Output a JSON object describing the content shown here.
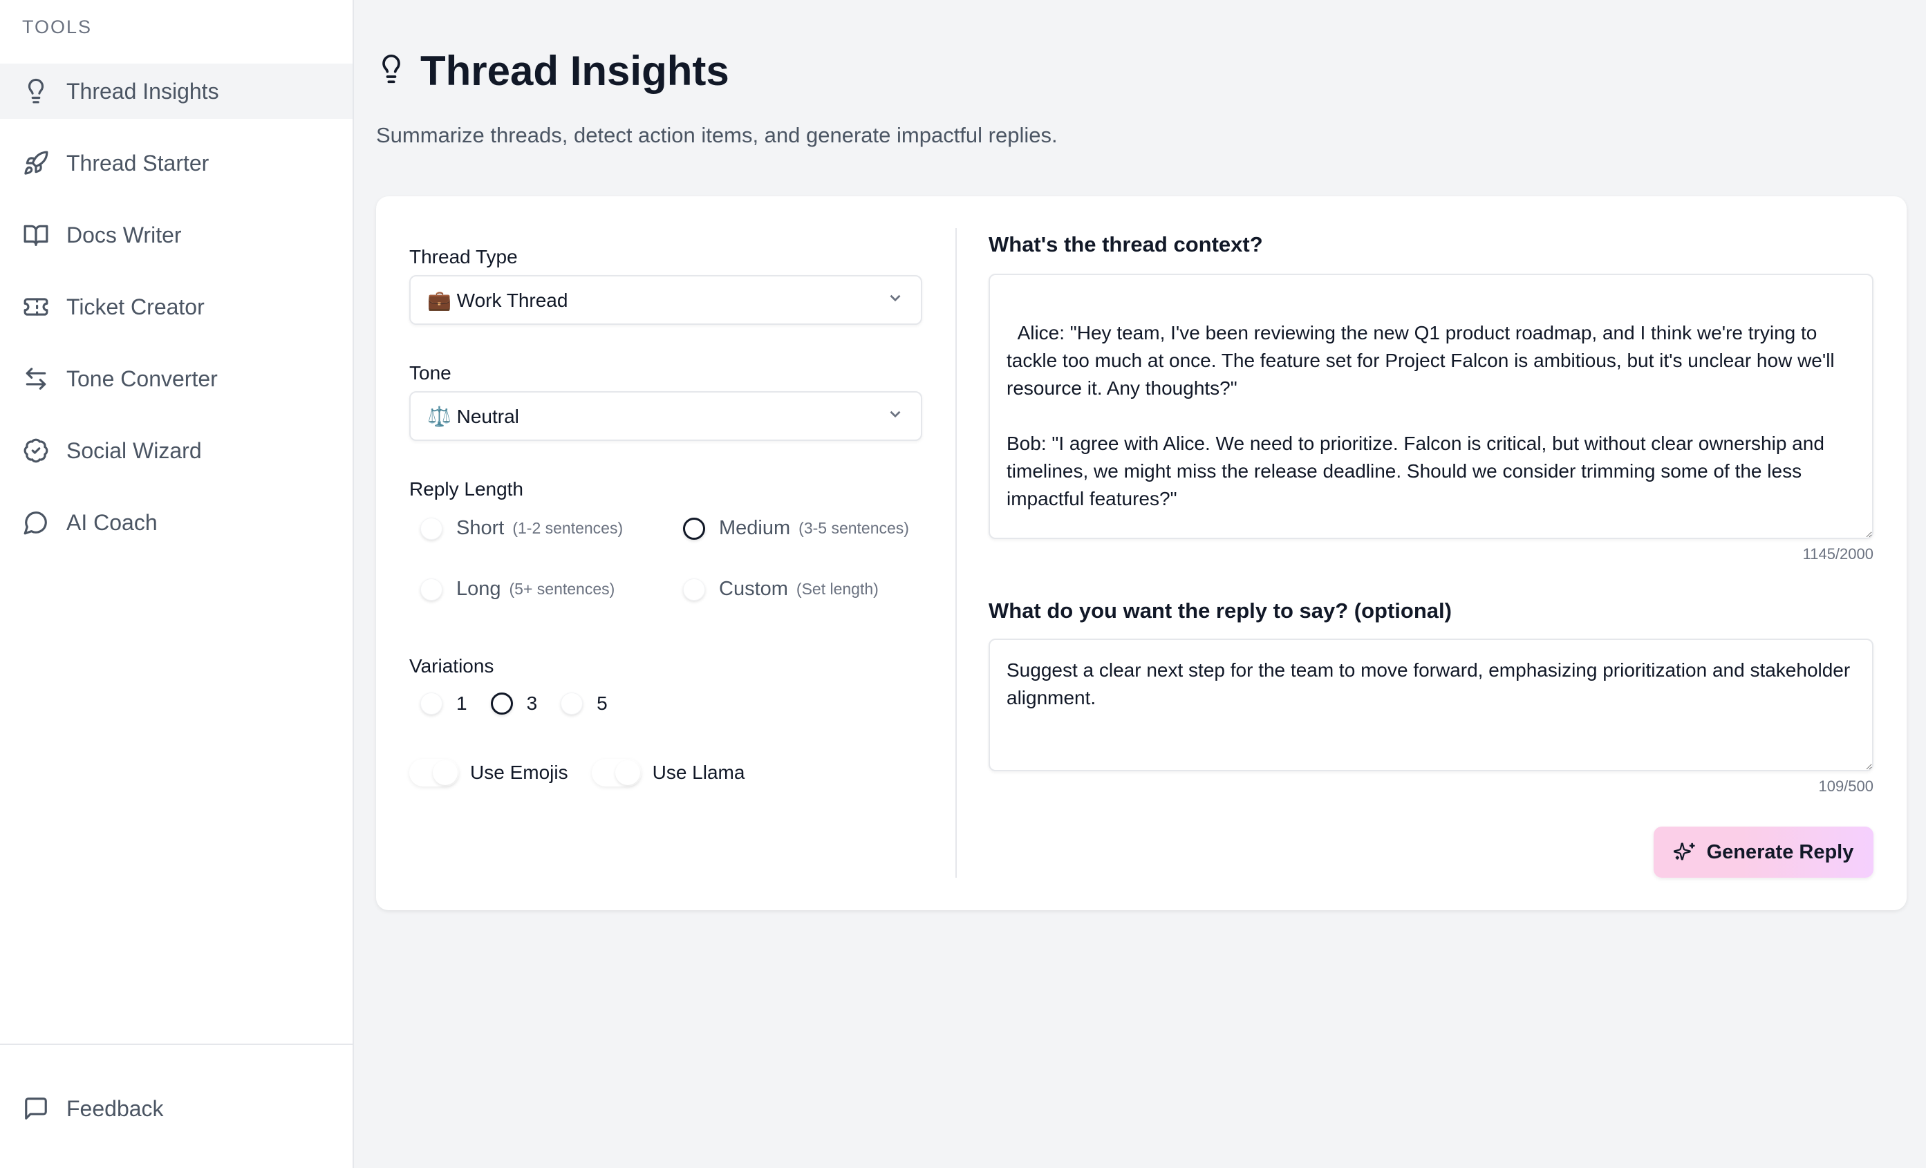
{
  "sidebar": {
    "heading": "TOOLS",
    "items": [
      {
        "label": "Thread Insights",
        "icon": "lightbulb-icon",
        "active": true
      },
      {
        "label": "Thread Starter",
        "icon": "rocket-icon",
        "active": false
      },
      {
        "label": "Docs Writer",
        "icon": "book-open-icon",
        "active": false
      },
      {
        "label": "Ticket Creator",
        "icon": "ticket-icon",
        "active": false
      },
      {
        "label": "Tone Converter",
        "icon": "arrows-left-right-icon",
        "active": false
      },
      {
        "label": "Social Wizard",
        "icon": "badge-check-icon",
        "active": false
      },
      {
        "label": "AI Coach",
        "icon": "message-circle-icon",
        "active": false
      }
    ],
    "footer": {
      "label": "Feedback",
      "icon": "message-square-icon"
    }
  },
  "header": {
    "icon": "lightbulb-icon",
    "title": "Thread Insights",
    "subtitle": "Summarize threads, detect action items, and generate impactful replies."
  },
  "form": {
    "thread_type": {
      "label": "Thread Type",
      "value": "💼 Work Thread"
    },
    "tone": {
      "label": "Tone",
      "value": "⚖️ Neutral"
    },
    "reply_length": {
      "label": "Reply Length",
      "selected": "Medium",
      "options": [
        {
          "label": "Short",
          "hint": "(1-2 sentences)"
        },
        {
          "label": "Medium",
          "hint": "(3-5 sentences)"
        },
        {
          "label": "Long",
          "hint": "(5+ sentences)"
        },
        {
          "label": "Custom",
          "hint": "(Set length)"
        }
      ]
    },
    "variations": {
      "label": "Variations",
      "selected": "3",
      "options": [
        "1",
        "3",
        "5"
      ]
    },
    "toggles": [
      {
        "label": "Use Emojis"
      },
      {
        "label": "Use Llama"
      }
    ],
    "context": {
      "label": "What's the thread context?",
      "value": "\n  Alice: \"Hey team, I've been reviewing the new Q1 product roadmap, and I think we're trying to tackle too much at once. The feature set for Project Falcon is ambitious, but it's unclear how we'll resource it. Any thoughts?\"\n\nBob: \"I agree with Alice. We need to prioritize. Falcon is critical, but without clear ownership and timelines, we might miss the release deadline. Should we consider trimming some of the less impactful features?\"",
      "counter": "1145/2000"
    },
    "reply_intent": {
      "label": "What do you want the reply to say? (optional)",
      "value": "Suggest a clear next step for the team to move forward, emphasizing prioritization and stakeholder alignment.",
      "counter": "109/500"
    },
    "generate_button": {
      "label": "Generate Reply",
      "icon": "sparkles-icon"
    }
  },
  "colors": {
    "accent_gradient_start": "#fbcfe8",
    "accent_gradient_end": "#f5d0fe",
    "sidebar_active_bg": "#f3f4f6",
    "page_bg": "#f3f4f6"
  }
}
